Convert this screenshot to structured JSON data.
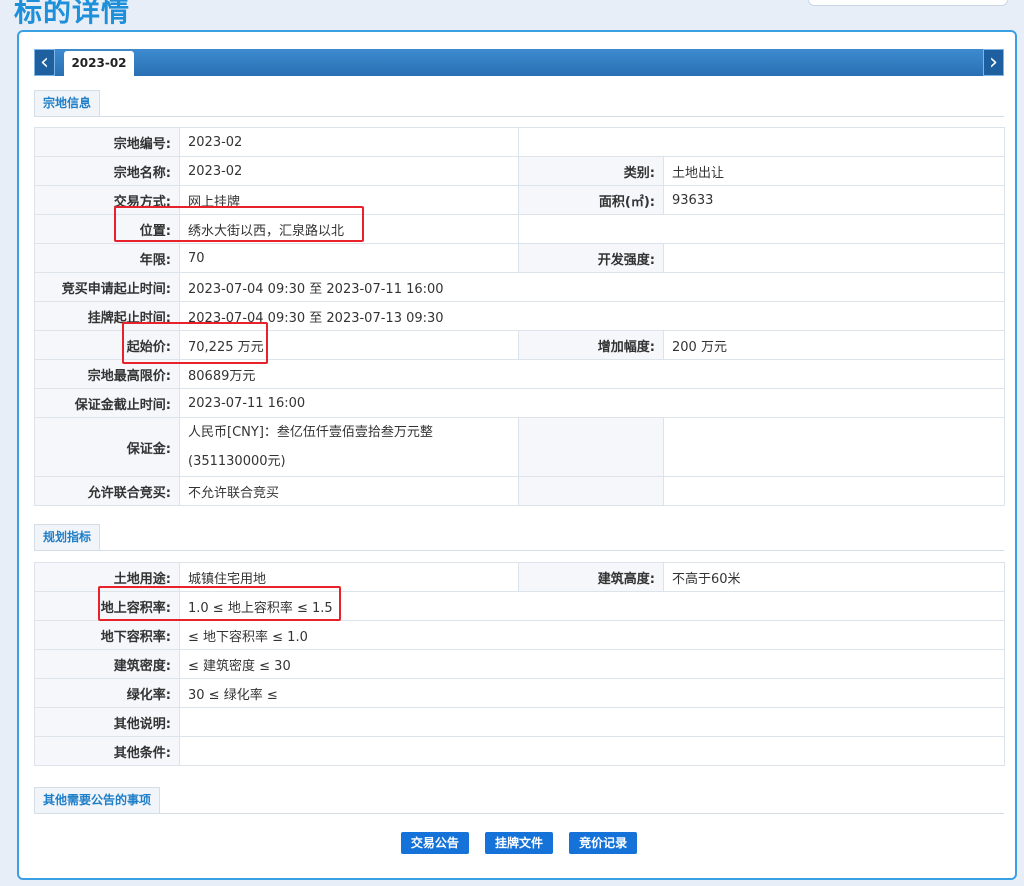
{
  "page": {
    "title": "标的详情"
  },
  "tabs": {
    "active": "2023-02",
    "prev_icon": "chevron-left",
    "next_icon": "chevron-right"
  },
  "sections": {
    "land_info": "宗地信息",
    "planning": "规划指标",
    "other": "其他需要公告的事项"
  },
  "land": {
    "parcel_no_label": "宗地编号:",
    "parcel_no": "2023-02",
    "parcel_name_label": "宗地名称:",
    "parcel_name": "2023-02",
    "category_label": "类别:",
    "category": "土地出让",
    "trade_mode_label": "交易方式:",
    "trade_mode": "网上挂牌",
    "area_label": "面积(㎡):",
    "area": "93633",
    "location_label": "位置:",
    "location": "绣水大街以西，汇泉路以北",
    "term_label": "年限:",
    "term": "70",
    "dev_intensity_label": "开发强度:",
    "dev_intensity": "",
    "apply_period_label": "竞买申请起止时间:",
    "apply_period": "2023-07-04 09:30 至 2023-07-11 16:00",
    "listing_period_label": "挂牌起止时间:",
    "listing_period": "2023-07-04 09:30 至 2023-07-13 09:30",
    "start_price_label": "起始价:",
    "start_price": "70,225 万元",
    "increment_label": "增加幅度:",
    "increment": "200 万元",
    "max_price_label": "宗地最高限价:",
    "max_price": "80689万元",
    "deposit_deadline_label": "保证金截止时间:",
    "deposit_deadline": "2023-07-11 16:00",
    "deposit_label": "保证金:",
    "deposit_line1": "人民币[CNY]：叁亿伍仟壹佰壹拾叁万元整",
    "deposit_line2": "(351130000元)",
    "joint_bid_label": "允许联合竞买:",
    "joint_bid": "不允许联合竞买"
  },
  "planning": {
    "land_use_label": "土地用途:",
    "land_use": "城镇住宅用地",
    "height_label": "建筑高度:",
    "height": "不高于60米",
    "far_above_label": "地上容积率:",
    "far_above": "1.0 ≤ 地上容积率 ≤ 1.5",
    "far_below_label": "地下容积率:",
    "far_below": "≤ 地下容积率 ≤ 1.0",
    "density_label": "建筑密度:",
    "density": "≤ 建筑密度 ≤ 30",
    "green_label": "绿化率:",
    "green": "30 ≤ 绿化率 ≤",
    "other_note_label": "其他说明:",
    "other_note": "",
    "other_cond_label": "其他条件:",
    "other_cond": ""
  },
  "buttons": {
    "announcement": "交易公告",
    "listing_docs": "挂牌文件",
    "bid_record": "竞价记录"
  }
}
